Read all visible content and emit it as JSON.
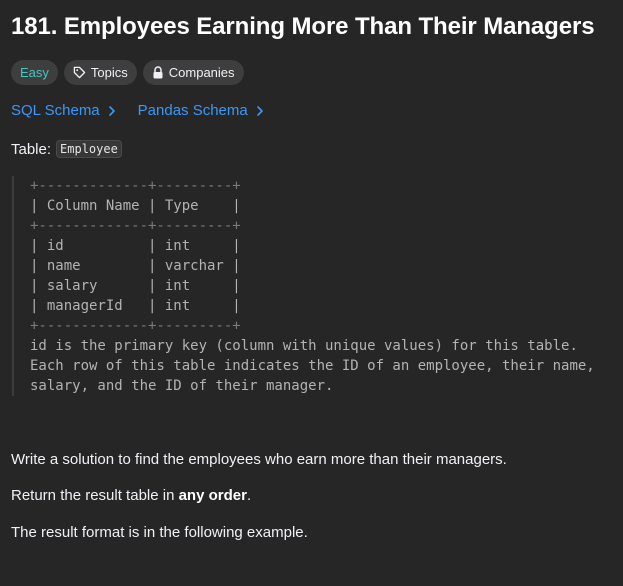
{
  "problem": {
    "title": "181. Employees Earning More Than Their Managers"
  },
  "badges": {
    "difficulty": "Easy",
    "topics": "Topics",
    "companies": "Companies"
  },
  "schema_links": {
    "sql": "SQL Schema",
    "pandas": "Pandas Schema"
  },
  "table_label": {
    "prefix": "Table:",
    "name": "Employee"
  },
  "schema_block": {
    "border_top": "+-------------+---------+",
    "header": "| Column Name | Type    |",
    "border_mid": "+-------------+---------+",
    "rows": [
      "| id          | int     |",
      "| name        | varchar |",
      "| salary      | int     |",
      "| managerId   | int     |"
    ],
    "border_bottom": "+-------------+---------+",
    "notes": [
      "id is the primary key (column with unique values) for this table.",
      "Each row of this table indicates the ID of an employee, their name,",
      "salary, and the ID of their manager."
    ]
  },
  "description": {
    "line1": "Write a solution to find the employees who earn more than their managers.",
    "line2_prefix": "Return the result table in ",
    "line2_bold": "any order",
    "line2_suffix": ".",
    "line3": "The result format is in the following example."
  },
  "colors": {
    "background": "#262626",
    "easy": "#46c6c2",
    "link": "#3b98f7",
    "badge_bg": "#3e3e3e"
  }
}
